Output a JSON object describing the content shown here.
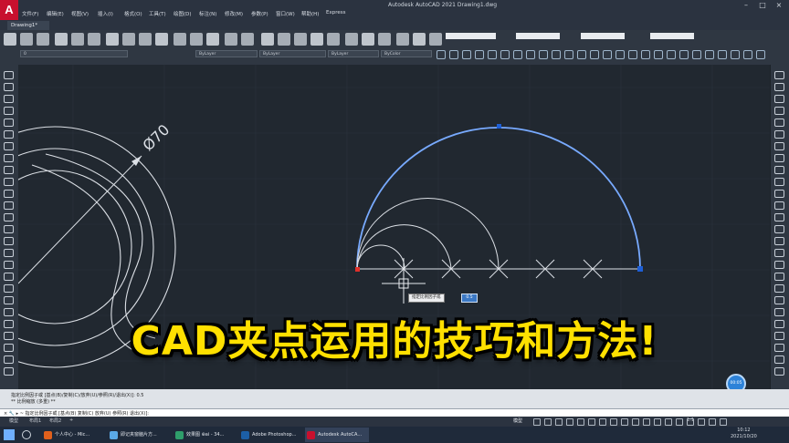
{
  "app": {
    "title": "Autodesk AutoCAD 2021    Drawing1.dwg",
    "logo": "A",
    "menu": [
      "文件(F)",
      "编辑(E)",
      "视图(V)",
      "插入(I)",
      "格式(O)",
      "工具(T)",
      "绘图(D)",
      "标注(N)",
      "修改(M)",
      "参数(P)",
      "窗口(W)",
      "帮助(H)",
      "Express"
    ]
  },
  "tabs": {
    "active": "Drawing1*"
  },
  "toolbar": {
    "layer_combo": "0",
    "color_combo": "ByLayer",
    "linetype_combo": "ByLayer",
    "lineweight_combo": "ByLayer",
    "plotstyle_combo": "ByColor"
  },
  "drawing": {
    "dimension_label": "Ø70",
    "tooltip_prompt": "指定比例因子或",
    "tooltip_value": "0.5",
    "zoom_badge": "00:05"
  },
  "headline": "CAD夹点运用的技巧和方法!",
  "command_history": [
    "指定比例因子或 [基点(B)/复制(C)/放弃(U)/参照(R)/退出(X)]: 0.5",
    "** 比例缩放 (多重) **"
  ],
  "command_prompt": "× 🔧 ▸ ~ 指定比例因子或 [基点(B) 复制(C) 放弃(U) 参照(R) 退出(X)]:",
  "status": {
    "layout_tabs": [
      "模型",
      "布局1",
      "布局2",
      "+"
    ],
    "mode": "模型",
    "scale": "1:1"
  },
  "taskbar": {
    "items": [
      {
        "label": "个人中心 - Mic...",
        "color": "#e0601c"
      },
      {
        "label": "即记夹窗脑片方...",
        "color": "#5aa9e6"
      },
      {
        "label": "效果图 ⊕ai - 34...",
        "color": "#2f9e6b"
      },
      {
        "label": "Adobe Photoshop...",
        "color": "#1c5fa6"
      },
      {
        "label": "Autodesk AutoCA...",
        "color": "#c8102e"
      }
    ],
    "time": "10:12",
    "weekday": "星期三",
    "date": "2021/10/20"
  },
  "colors": {
    "canvas": "#212830",
    "arc_selected": "#78aaff",
    "lines": "#dce0e6",
    "grip_blue": "#1e5fd6",
    "grip_red": "#e0302a",
    "headline": "#ffe000"
  }
}
